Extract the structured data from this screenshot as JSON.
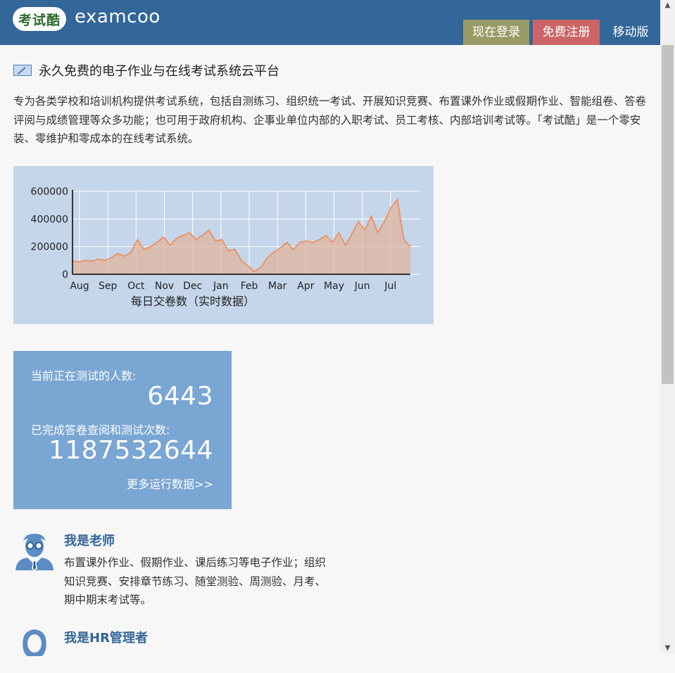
{
  "header": {
    "logo_badge": "考试酷",
    "logo_text": "examcoo",
    "nav": {
      "login": "现在登录",
      "register": "免费注册",
      "mobile": "移动版"
    }
  },
  "headline": "永久免费的电子作业与在线考试系统云平台",
  "intro": "专为各类学校和培训机构提供考试系统，包括自测练习、组织统一考试、开展知识竞赛、布置课外作业或假期作业、智能组卷、答卷评阅与成绩管理等众多功能；也可用于政府机构、企事业单位内部的入职考试、员工考核、内部培训考试等。「考试酷」是一个零安装、零维护和零成本的在线考试系统。",
  "chart_data": {
    "type": "area",
    "xlabel": "每日交卷数（实时数据）",
    "ylabel": "",
    "ylim": [
      0,
      600000
    ],
    "yticks": [
      0,
      200000,
      400000,
      600000
    ],
    "ytick_labels": [
      "0",
      "200000",
      "400000",
      "600000"
    ],
    "months": [
      "Aug",
      "Sep",
      "Oct",
      "Nov",
      "Dec",
      "Jan",
      "Feb",
      "Mar",
      "Apr",
      "May",
      "Jun",
      "Jul"
    ],
    "x_unit": "weeks since start of Aug",
    "x": [
      0,
      1,
      2,
      3,
      4,
      5,
      6,
      7,
      8,
      9,
      10,
      11,
      12,
      13,
      14,
      15,
      16,
      17,
      18,
      19,
      20,
      21,
      22,
      23,
      24,
      25,
      26,
      27,
      28,
      29,
      30,
      31,
      32,
      33,
      34,
      35,
      36,
      37,
      38,
      39,
      40,
      41,
      42,
      43,
      44,
      45,
      46,
      47,
      48,
      49,
      50,
      51,
      52
    ],
    "values": [
      95000,
      90000,
      100000,
      95000,
      110000,
      100000,
      120000,
      150000,
      130000,
      160000,
      250000,
      180000,
      200000,
      230000,
      270000,
      210000,
      260000,
      280000,
      300000,
      250000,
      280000,
      320000,
      240000,
      250000,
      170000,
      180000,
      100000,
      60000,
      20000,
      50000,
      120000,
      160000,
      190000,
      230000,
      180000,
      230000,
      240000,
      230000,
      250000,
      280000,
      230000,
      300000,
      210000,
      290000,
      380000,
      320000,
      420000,
      300000,
      380000,
      480000,
      540000,
      250000,
      200000
    ],
    "color": "#e8956a",
    "fill": "#e0b49e",
    "background": "#c5d6ea",
    "grid": true
  },
  "stats": {
    "online_label": "当前正在测试的人数:",
    "online_value": "6443",
    "done_label": "已完成答卷查阅和测试次数:",
    "done_value": "1187532644",
    "more_link": "更多运行数据>>"
  },
  "roles": [
    {
      "title": "我是老师",
      "desc": "布置课外作业、假期作业、课后练习等电子作业；组织知识竞赛、安排章节练习、随堂测验、周测验、月考、期中期末考试等。",
      "icon": "teacher-icon"
    },
    {
      "title": "我是HR管理者",
      "desc": "",
      "icon": "hr-manager-icon"
    }
  ]
}
